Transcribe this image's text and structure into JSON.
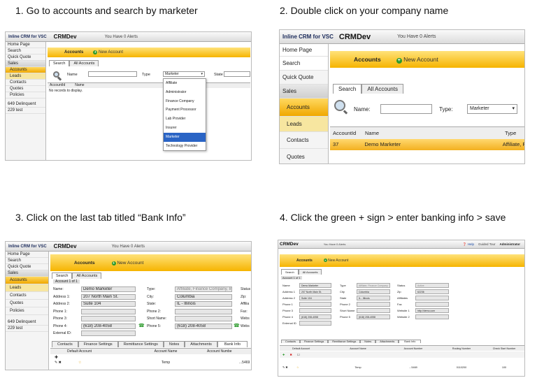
{
  "steps": [
    {
      "caption": "1. Go to accounts and search by marketer"
    },
    {
      "caption": "2. Double click on your company name"
    },
    {
      "caption": "3. Click on the last tab titled “Bank Info”"
    },
    {
      "caption": "4. Click the green + sign > enter banking info > save"
    }
  ],
  "app": {
    "logo": "Inline CRM for VSC",
    "env": "CRMDev",
    "alerts": "You Have 0 Alerts",
    "alerts_short": "You Have 0 Alerts",
    "sidebar": [
      "Home Page",
      "Search",
      "Quick Quote",
      "Sales",
      "Accounts",
      "Leads",
      "Contacts",
      "Quotes",
      "Policies",
      "649 Delinquent",
      "229 test"
    ],
    "panel_title": "Accounts",
    "new_account": "New Account",
    "tab_search": "Search",
    "tab_all": "All Accounts"
  },
  "shot1": {
    "name_label": "Name",
    "type_label": "Type",
    "type_value": "Marketer",
    "state_label": "State",
    "col_accountid": "AccountId",
    "col_name": "Name",
    "no_records": "No records to display.",
    "dropdown": [
      "Affiliate",
      "Administrator",
      "Finance Company",
      "Payment Processor",
      "Lab Provider",
      "Insurer",
      "Marketer",
      "Technology Provider"
    ]
  },
  "shot2": {
    "name_label": "Name:",
    "type_label": "Type:",
    "type_value": "Marketer",
    "col_accountid": "AccountId",
    "col_name": "Name",
    "col_type": "Type",
    "row_id": "37",
    "row_name": "Demo Marketer",
    "row_type": "Affiliate, F"
  },
  "shot3": {
    "account_header": "Account 1 of 1",
    "fields": {
      "name": "Demo Marketer",
      "address1": "207 North Main St.",
      "address2": "Suite 104",
      "phone4": "(618) 208-4058",
      "type": "Affiliate, Finance Company, In",
      "city": "Columbia",
      "state": "IL - Illinois",
      "phone5": "(618) 208-4058"
    },
    "labels": {
      "name": "Name:",
      "address1": "Address 1:",
      "address2": "Address 2:",
      "phone1": "Phone 1:",
      "phone3": "Phone 3:",
      "phone4": "Phone 4:",
      "external": "External ID:",
      "type": "Type:",
      "city": "City:",
      "state": "State:",
      "phone2": "Phone 2:",
      "short": "Short Name:",
      "phone5": "Phone 5:",
      "status": "Status",
      "zip": "Zip:",
      "affil": "Affilia",
      "fax": "Fax:",
      "webs": "Webs",
      "web2": "Webs"
    },
    "tabs": [
      "Contacts",
      "Finance Settings",
      "Remittance Settings",
      "Notes",
      "Attachments",
      "Bank Info"
    ],
    "grid_cols": [
      "Default Account",
      "Account Name",
      "Account Numbe"
    ],
    "row_name": "Temp",
    "row_num": "...5469"
  },
  "shot4": {
    "alerts": "You Have 0 Alerts",
    "help": "Help",
    "guide": "Guided Tour",
    "admin": "Administrator",
    "fields": {
      "name": "Demo Marketer",
      "address1": "207 North Main St.",
      "address2": "Suite 104",
      "phone4": "(618) 208-4058",
      "type": "Affiliate, Finance Company",
      "city": "Columbia",
      "state": "IL - Illinois",
      "phone5": "(618) 208-4058",
      "status": "Active",
      "zip": "62236",
      "website": "http://demo.com"
    },
    "labels": [
      "Name",
      "Address 1",
      "Address 2",
      "Phone 1",
      "Phone 3",
      "Phone 4",
      "External ID",
      "Type",
      "City",
      "State",
      "Phone 2",
      "Short Name",
      "Phone 5",
      "Status",
      "Zip",
      "Affiliates",
      "Fax",
      "Website 1",
      "Website 2"
    ],
    "tabs": [
      "Contacts",
      "Finance Settings",
      "Remittance Settings",
      "Notes",
      "Attachments",
      "Bank Info"
    ],
    "grid_cols": [
      "Default Account",
      "Account Name",
      "Account Number",
      "Routing Number",
      "Check Start Number"
    ],
    "row": [
      "Temp",
      "...5469",
      "0110200",
      "100"
    ]
  }
}
